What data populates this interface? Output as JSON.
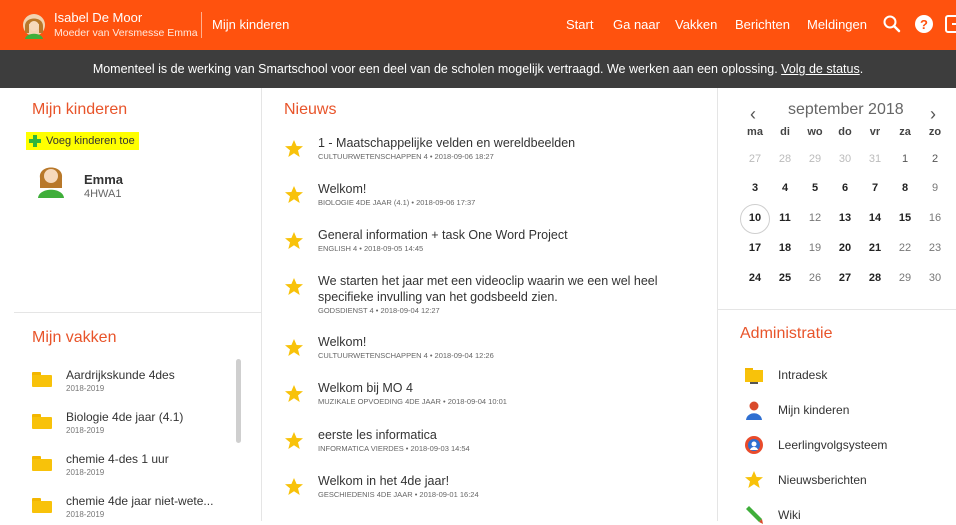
{
  "colors": {
    "brand": "#ff520e",
    "banner": "#3d3d3d",
    "accent": "#e8542a",
    "star": "#f8c20a"
  },
  "topbar": {
    "user_name": "Isabel De Moor",
    "user_role": "Moeder van Versmesse Emma",
    "title": "Mijn kinderen",
    "nav": [
      "Start",
      "Ga naar",
      "Vakken",
      "Berichten",
      "Meldingen"
    ],
    "icons": [
      "search-icon",
      "help-icon",
      "logout-icon"
    ]
  },
  "banner": {
    "text": "Momenteel is de werking van Smartschool voor een deel van de scholen mogelijk vertraagd. We werken aan een oplossing.",
    "link": "Volg de status",
    "suffix": "."
  },
  "children": {
    "title": "Mijn kinderen",
    "add_label": "Voeg kinderen toe",
    "items": [
      {
        "name": "Emma",
        "class": "4HWA1"
      }
    ]
  },
  "courses": {
    "title": "Mijn vakken",
    "items": [
      {
        "name": "Aardrijkskunde 4des",
        "year": "2018-2019"
      },
      {
        "name": "Biologie 4de jaar (4.1)",
        "year": "2018-2019"
      },
      {
        "name": "chemie 4-des 1 uur",
        "year": "2018-2019"
      },
      {
        "name": "chemie 4de jaar niet-wete...",
        "year": "2018-2019"
      }
    ]
  },
  "news": {
    "title": "Nieuws",
    "items": [
      {
        "title": "1 - Maatschappelijke velden en wereldbeelden",
        "meta": "CULTUURWETENSCHAPPEN 4 • 2018-09-06 18:27"
      },
      {
        "title": "Welkom!",
        "meta": "BIOLOGIE 4DE JAAR (4.1) • 2018-09-06 17:37"
      },
      {
        "title": "General information + task One Word Project",
        "meta": "ENGLISH 4 • 2018-09-05 14:45"
      },
      {
        "title": "We starten het jaar met een videoclip waarin we een wel heel specifieke invulling van het godsbeeld zien.",
        "meta": "GODSDIENST 4 • 2018-09-04 12:27"
      },
      {
        "title": "Welkom!",
        "meta": "CULTUURWETENSCHAPPEN 4 • 2018-09-04 12:26"
      },
      {
        "title": "Welkom bij MO 4",
        "meta": "MUZIKALE OPVOEDING 4DE JAAR • 2018-09-04 10:01"
      },
      {
        "title": "eerste les informatica",
        "meta": "INFORMATICA VIERDES • 2018-09-03 14:54"
      },
      {
        "title": "Welkom in het 4de jaar!",
        "meta": "GESCHIEDENIS 4DE JAAR • 2018-09-01 16:24"
      }
    ]
  },
  "calendar": {
    "month": "september 2018",
    "prev": "‹",
    "next": "›",
    "dow": [
      "ma",
      "di",
      "wo",
      "do",
      "vr",
      "za",
      "zo"
    ],
    "weeks": [
      [
        "27",
        "28",
        "29",
        "30",
        "31",
        "1",
        "2"
      ],
      [
        "3",
        "4",
        "5",
        "6",
        "7",
        "8",
        "9"
      ],
      [
        "10",
        "11",
        "12",
        "13",
        "14",
        "15",
        "16"
      ],
      [
        "17",
        "18",
        "19",
        "20",
        "21",
        "22",
        "23"
      ],
      [
        "24",
        "25",
        "26",
        "27",
        "28",
        "29",
        "30"
      ]
    ],
    "today": "10"
  },
  "admin": {
    "title": "Administratie",
    "items": [
      {
        "label": "Intradesk",
        "icon": "folder-icon"
      },
      {
        "label": "Mijn kinderen",
        "icon": "child-icon"
      },
      {
        "label": "Leerlingvolgsysteem",
        "icon": "tracking-icon"
      },
      {
        "label": "Nieuwsberichten",
        "icon": "star-icon"
      },
      {
        "label": "Wiki",
        "icon": "pencil-icon"
      }
    ]
  }
}
